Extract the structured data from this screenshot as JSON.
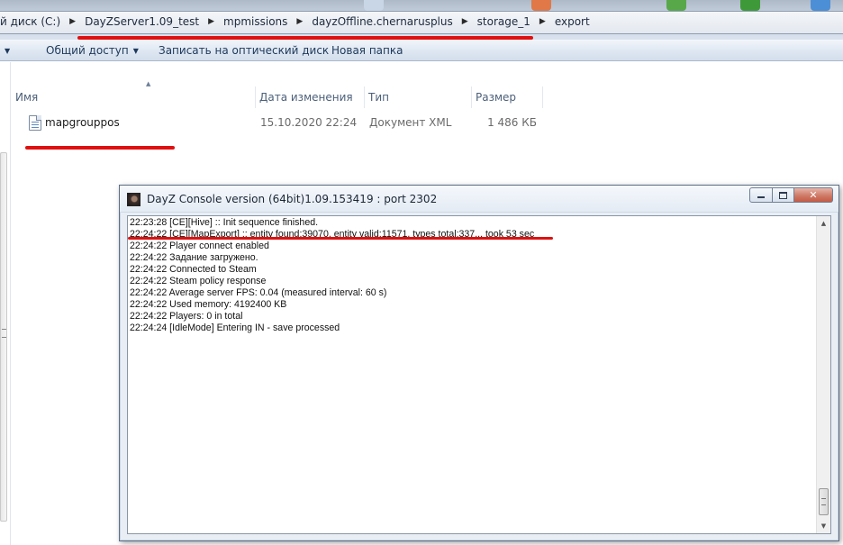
{
  "explorer": {
    "breadcrumb": [
      "й диск (C:)",
      "DayZServer1.09_test",
      "mpmissions",
      "dayzOffline.chernarusplus",
      "storage_1",
      "export"
    ],
    "toolbar": {
      "share_label": "Общий доступ",
      "burn_label": "Записать на оптический диск",
      "new_folder_label": "Новая папка"
    },
    "columns": {
      "name": "Имя",
      "date": "Дата изменения",
      "type": "Тип",
      "size": "Размер"
    },
    "files": [
      {
        "name": "mapgrouppos",
        "date": "15.10.2020 22:24",
        "type": "Документ XML",
        "size": "1 486 КБ",
        "icon": "xml-file-icon"
      }
    ]
  },
  "console": {
    "title": "DayZ Console version (64bit)1.09.153419 : port 2302",
    "icon": "dayz-app-icon",
    "log": [
      "22:23:28 [CE][Hive] :: Init sequence finished.",
      "22:24:22 [CE][MapExport] :: entity found:39070, entity valid:11571, types total:337... took 53 sec",
      "22:24:22 Player connect enabled",
      "22:24:22 Задание загружено.",
      "22:24:22 Connected to Steam",
      "22:24:22 Steam policy response",
      "22:24:22 Average server FPS: 0.04 (measured interval: 60 s)",
      "22:24:22 Used memory: 4192400 KB",
      "22:24:22 Players: 0 in total",
      "22:24:24 [IdleMode] Entering IN - save processed"
    ]
  },
  "annotation_color": "#e01010"
}
